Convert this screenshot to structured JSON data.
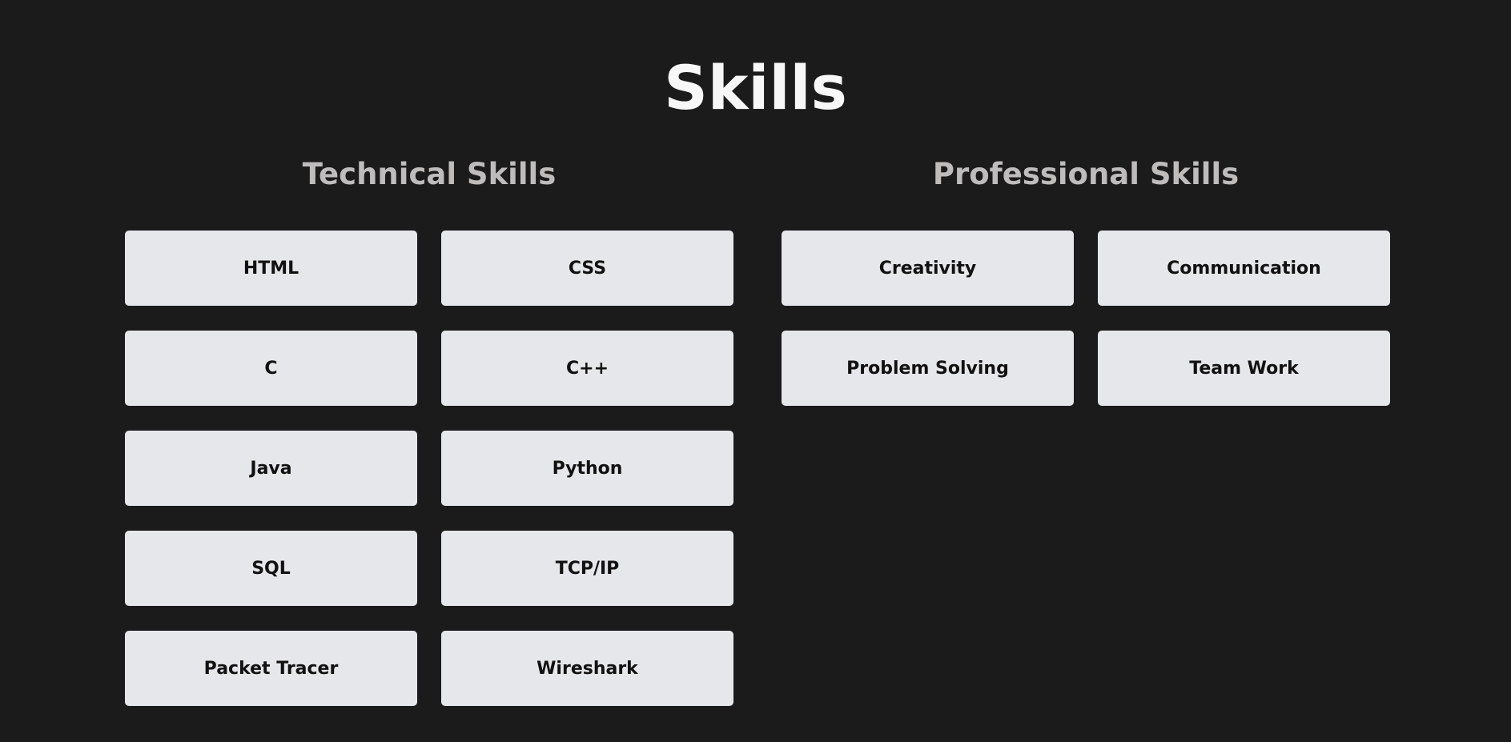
{
  "page": {
    "title": "Skills"
  },
  "technical": {
    "title": "Technical Skills",
    "items": [
      "HTML",
      "CSS",
      "C",
      "C++",
      "Java",
      "Python",
      "SQL",
      "TCP/IP",
      "Packet Tracer",
      "Wireshark"
    ]
  },
  "professional": {
    "title": "Professional Skills",
    "items": [
      "Creativity",
      "Communication",
      "Problem Solving",
      "Team Work"
    ]
  },
  "colors": {
    "background": "#1b1b1b",
    "title": "#f7f7f7",
    "section_title": "#bfbcbc",
    "card_background": "#e6e7ea",
    "card_text": "#111111"
  }
}
